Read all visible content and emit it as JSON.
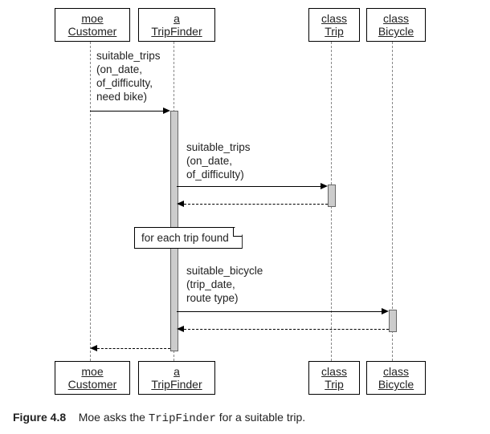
{
  "participants": {
    "p1": {
      "line1": "moe",
      "line2": "Customer"
    },
    "p2": {
      "line1": "a",
      "line2": "TripFinder"
    },
    "p3": {
      "line1": "class",
      "line2": "Trip"
    },
    "p4": {
      "line1": "class",
      "line2": "Bicycle"
    }
  },
  "messages": {
    "m1": "suitable_trips\n(on_date,\nof_difficulty,\nneed bike)",
    "m2": "suitable_trips\n(on_date,\nof_difficulty)",
    "m3": "suitable_bicycle\n(trip_date,\nroute type)"
  },
  "note": "for each trip found",
  "caption": {
    "fignum": "Figure 4.8",
    "textA": "Moe asks the ",
    "mono": "TripFinder",
    "textB": " for a suitable trip."
  }
}
